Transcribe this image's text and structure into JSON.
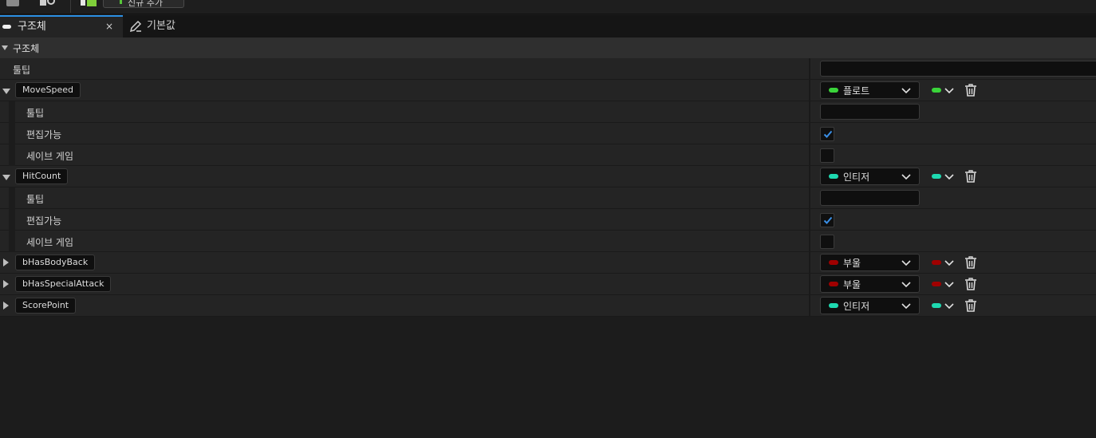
{
  "toolbar": {
    "icons": [
      "save-icon",
      "find-icon",
      "checkmark-icon"
    ],
    "add_button_label": "신규 추가"
  },
  "tabs": [
    {
      "label": "구조체",
      "active": true,
      "close": "×"
    },
    {
      "label": "기본값",
      "active": false
    }
  ],
  "section": {
    "title": "구조체"
  },
  "struct_tooltip_label": "툴팁",
  "colors": {
    "float": "#3ad43a",
    "integer": "#1ed9b0",
    "boolean": "#a00000",
    "accent": "#2b8fe3",
    "check": "#3a8fe6"
  },
  "members": [
    {
      "name": "MoveSpeed",
      "type": "플로트",
      "type_key": "float",
      "expanded": true,
      "props": [
        {
          "label": "툴팁",
          "kind": "text",
          "value": ""
        },
        {
          "label": "편집가능",
          "kind": "check",
          "checked": true
        },
        {
          "label": "세이브 게임",
          "kind": "check",
          "checked": false
        }
      ]
    },
    {
      "name": "HitCount",
      "type": "인티저",
      "type_key": "integer",
      "expanded": true,
      "props": [
        {
          "label": "툴팁",
          "kind": "text",
          "value": ""
        },
        {
          "label": "편집가능",
          "kind": "check",
          "checked": true
        },
        {
          "label": "세이브 게임",
          "kind": "check",
          "checked": false
        }
      ]
    },
    {
      "name": "bHasBodyBack",
      "type": "부울",
      "type_key": "boolean",
      "expanded": false,
      "props": []
    },
    {
      "name": "bHasSpecialAttack",
      "type": "부울",
      "type_key": "boolean",
      "expanded": false,
      "props": []
    },
    {
      "name": "ScorePoint",
      "type": "인티저",
      "type_key": "integer",
      "expanded": false,
      "props": []
    }
  ]
}
